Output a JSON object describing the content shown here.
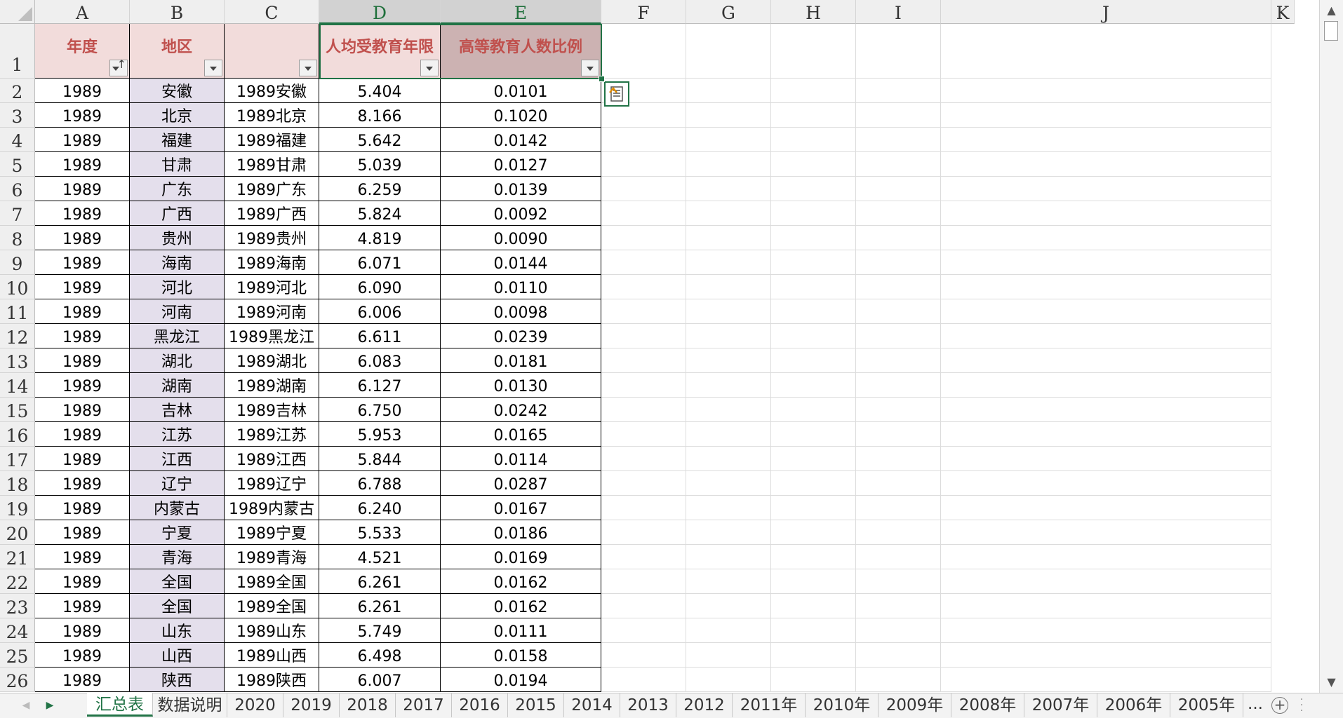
{
  "columns": [
    "A",
    "B",
    "C",
    "D",
    "E",
    "F",
    "G",
    "H",
    "I",
    "J",
    "K"
  ],
  "selected_columns": [
    "D",
    "E"
  ],
  "header_row": {
    "row_number": "1",
    "cells": [
      "年度",
      "地区",
      "",
      "人均受教育年限",
      "高等教育人数比例"
    ]
  },
  "rows": [
    {
      "n": "2",
      "year": "1989",
      "region": "安徽",
      "key": "1989安徽",
      "edu_years": "5.404",
      "higher_ratio": "0.0101"
    },
    {
      "n": "3",
      "year": "1989",
      "region": "北京",
      "key": "1989北京",
      "edu_years": "8.166",
      "higher_ratio": "0.1020"
    },
    {
      "n": "4",
      "year": "1989",
      "region": "福建",
      "key": "1989福建",
      "edu_years": "5.642",
      "higher_ratio": "0.0142"
    },
    {
      "n": "5",
      "year": "1989",
      "region": "甘肃",
      "key": "1989甘肃",
      "edu_years": "5.039",
      "higher_ratio": "0.0127"
    },
    {
      "n": "6",
      "year": "1989",
      "region": "广东",
      "key": "1989广东",
      "edu_years": "6.259",
      "higher_ratio": "0.0139"
    },
    {
      "n": "7",
      "year": "1989",
      "region": "广西",
      "key": "1989广西",
      "edu_years": "5.824",
      "higher_ratio": "0.0092"
    },
    {
      "n": "8",
      "year": "1989",
      "region": "贵州",
      "key": "1989贵州",
      "edu_years": "4.819",
      "higher_ratio": "0.0090"
    },
    {
      "n": "9",
      "year": "1989",
      "region": "海南",
      "key": "1989海南",
      "edu_years": "6.071",
      "higher_ratio": "0.0144"
    },
    {
      "n": "10",
      "year": "1989",
      "region": "河北",
      "key": "1989河北",
      "edu_years": "6.090",
      "higher_ratio": "0.0110"
    },
    {
      "n": "11",
      "year": "1989",
      "region": "河南",
      "key": "1989河南",
      "edu_years": "6.006",
      "higher_ratio": "0.0098"
    },
    {
      "n": "12",
      "year": "1989",
      "region": "黑龙江",
      "key": "1989黑龙江",
      "edu_years": "6.611",
      "higher_ratio": "0.0239"
    },
    {
      "n": "13",
      "year": "1989",
      "region": "湖北",
      "key": "1989湖北",
      "edu_years": "6.083",
      "higher_ratio": "0.0181"
    },
    {
      "n": "14",
      "year": "1989",
      "region": "湖南",
      "key": "1989湖南",
      "edu_years": "6.127",
      "higher_ratio": "0.0130"
    },
    {
      "n": "15",
      "year": "1989",
      "region": "吉林",
      "key": "1989吉林",
      "edu_years": "6.750",
      "higher_ratio": "0.0242"
    },
    {
      "n": "16",
      "year": "1989",
      "region": "江苏",
      "key": "1989江苏",
      "edu_years": "5.953",
      "higher_ratio": "0.0165"
    },
    {
      "n": "17",
      "year": "1989",
      "region": "江西",
      "key": "1989江西",
      "edu_years": "5.844",
      "higher_ratio": "0.0114"
    },
    {
      "n": "18",
      "year": "1989",
      "region": "辽宁",
      "key": "1989辽宁",
      "edu_years": "6.788",
      "higher_ratio": "0.0287"
    },
    {
      "n": "19",
      "year": "1989",
      "region": "内蒙古",
      "key": "1989内蒙古",
      "edu_years": "6.240",
      "higher_ratio": "0.0167"
    },
    {
      "n": "20",
      "year": "1989",
      "region": "宁夏",
      "key": "1989宁夏",
      "edu_years": "5.533",
      "higher_ratio": "0.0186"
    },
    {
      "n": "21",
      "year": "1989",
      "region": "青海",
      "key": "1989青海",
      "edu_years": "4.521",
      "higher_ratio": "0.0169"
    },
    {
      "n": "22",
      "year": "1989",
      "region": "全国",
      "key": "1989全国",
      "edu_years": "6.261",
      "higher_ratio": "0.0162"
    },
    {
      "n": "23",
      "year": "1989",
      "region": "全国",
      "key": "1989全国",
      "edu_years": "6.261",
      "higher_ratio": "0.0162"
    },
    {
      "n": "24",
      "year": "1989",
      "region": "山东",
      "key": "1989山东",
      "edu_years": "5.749",
      "higher_ratio": "0.0111"
    },
    {
      "n": "25",
      "year": "1989",
      "region": "山西",
      "key": "1989山西",
      "edu_years": "6.498",
      "higher_ratio": "0.0158"
    },
    {
      "n": "26",
      "year": "1989",
      "region": "陕西",
      "key": "1989陕西",
      "edu_years": "6.007",
      "higher_ratio": "0.0194"
    }
  ],
  "sheet_tabs": [
    "汇总表",
    "数据说明",
    "2020",
    "2019",
    "2018",
    "2017",
    "2016",
    "2015",
    "2014",
    "2013",
    "2012",
    "2011年",
    "2010年",
    "2009年",
    "2008年",
    "2007年",
    "2006年",
    "2005年"
  ],
  "active_tab": "汇总表",
  "tabs_overflow": "...",
  "colors": {
    "accent": "#217346",
    "header_text": "#c0504d",
    "header_fill": "#f2dcdb",
    "header_fill_selected": "#ccb2b2",
    "col_b_fill": "#e4dfec"
  }
}
